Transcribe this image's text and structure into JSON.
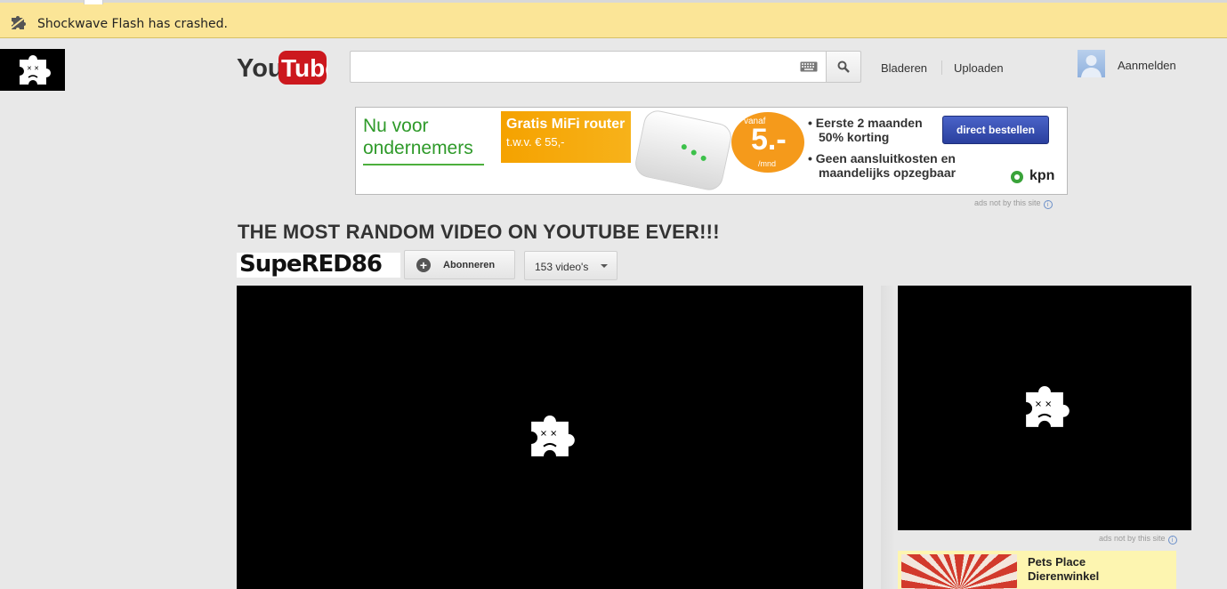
{
  "crash_bar": {
    "message": "Shockwave Flash has crashed.",
    "icon": "puzzle-piece-icon"
  },
  "header": {
    "logo_you": "You",
    "logo_tube": "Tube",
    "search": {
      "value": "",
      "placeholder": ""
    },
    "nav": {
      "browse": "Bladeren",
      "upload": "Uploaden"
    },
    "signin": "Aanmelden"
  },
  "ad_banner": {
    "headline_1": "Nu voor",
    "headline_2": "ondernemers",
    "offer_1": "Gratis MiFi router",
    "offer_2": "t.w.v. € 55,-",
    "price_prefix": "vanaf",
    "price": "5.-",
    "price_suffix": "/mnd",
    "bullet_1a": "Eerste 2 maanden",
    "bullet_1b": "50% korting",
    "bullet_2a": "Geen aansluitkosten en",
    "bullet_2b": "maandelijks opzegbaar",
    "cta": "direct bestellen",
    "brand": "kpn",
    "disclaimer": "ads not by this site"
  },
  "video": {
    "title": "THE MOST RANDOM VIDEO ON YOUTUBE EVER!!!",
    "channel_name": "SupeRED86",
    "subscribe_label": "Abonneren",
    "videos_count_label": "153 video's"
  },
  "sidebar": {
    "ad_disclaimer": "ads not by this site",
    "promo_title_1": "Pets Place",
    "promo_title_2": "Dierenwinkel"
  },
  "colors": {
    "crash_bar_bg": "#fbe597",
    "youtube_red": "#cc181e",
    "ad_green": "#2f9a2a",
    "ad_orange": "#f59a1b",
    "cta_blue": "#2a3f9e"
  }
}
